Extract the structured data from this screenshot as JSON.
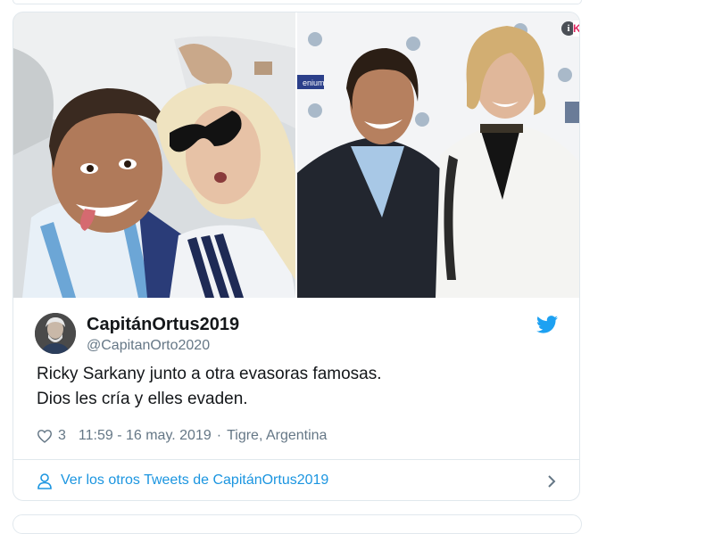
{
  "tweet": {
    "display_name": "CapitánOrtus2019",
    "username": "@CapitanOrto2020",
    "text_line1": "Ricky Sarkany junto a otra evasoras famosas.",
    "text_line2": "Dios les cría y elles evaden.",
    "like_count": "3",
    "timestamp": "11:59 - 16 may. 2019",
    "separator": "·",
    "location": "Tigre, Argentina"
  },
  "media": {
    "left_photo_alt": "selfie",
    "right_photo_alt": "couple",
    "info_icon": "i",
    "info_k": "K",
    "backdrop_brand": "enium"
  },
  "footer": {
    "link_text": "Ver los otros Tweets de CapitánOrtus2019"
  },
  "icons": {
    "twitter": "twitter-bird-icon",
    "heart": "heart-icon",
    "user": "user-icon",
    "chevron": "chevron-right-icon"
  },
  "colors": {
    "twitter_blue": "#1da1f2",
    "link_blue": "#1b95e0",
    "meta_gray": "#657786",
    "border": "#e1e8ed"
  }
}
